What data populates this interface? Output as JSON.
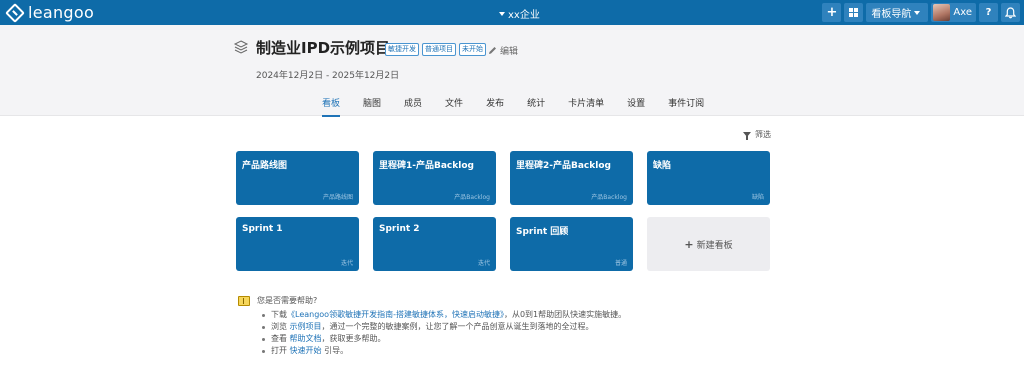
{
  "topbar": {
    "logo_text": "leangoo",
    "org_name": "xx企业",
    "board_nav_label": "看板导航",
    "user_name": "Axe",
    "help_label": "?",
    "icons": [
      "plus-icon",
      "grid-icon",
      "caret-down-icon",
      "bell-icon"
    ]
  },
  "project": {
    "title": "制造业IPD示例项目",
    "tags": [
      "敏捷开发",
      "普通项目",
      "未开始"
    ],
    "edit_label": "编辑",
    "date_range": "2024年12月2日 - 2025年12月2日"
  },
  "tabs": [
    {
      "label": "看板",
      "active": true
    },
    {
      "label": "脑图"
    },
    {
      "label": "成员"
    },
    {
      "label": "文件"
    },
    {
      "label": "发布"
    },
    {
      "label": "统计"
    },
    {
      "label": "卡片清单"
    },
    {
      "label": "设置"
    },
    {
      "label": "事件订阅"
    }
  ],
  "filter_label": "筛选",
  "boards": [
    {
      "name": "产品路线图",
      "type": "产品路线图"
    },
    {
      "name": "里程碑1-产品Backlog",
      "type": "产品Backlog"
    },
    {
      "name": "里程碑2-产品Backlog",
      "type": "产品Backlog"
    },
    {
      "name": "缺陷",
      "type": "缺陷"
    },
    {
      "name": "Sprint 1",
      "type": "迭代"
    },
    {
      "name": "Sprint 2",
      "type": "迭代"
    },
    {
      "name": "Sprint 回顾",
      "type": "普通"
    }
  ],
  "new_board_label": "新建看板",
  "help": {
    "title": "您是否需要帮助?",
    "items": [
      {
        "prefix": "下载",
        "link": "《Leangoo领歌敏捷开发指南-搭建敏捷体系，快速启动敏捷》",
        "suffix": "，从0到1帮助团队快速实施敏捷。"
      },
      {
        "prefix": "浏览",
        "link": "示例项目",
        "suffix": "，通过一个完整的敏捷案例，让您了解一个产品创意从诞生到落地的全过程。"
      },
      {
        "prefix": "查看",
        "link": "帮助文档",
        "suffix": "，获取更多帮助。"
      },
      {
        "prefix": "打开",
        "link": "快速开始",
        "suffix": "引导。"
      }
    ]
  },
  "colors": {
    "brand": "#0e6ba8",
    "link": "#1f73b7",
    "header_bg": "#f4f4f6"
  }
}
